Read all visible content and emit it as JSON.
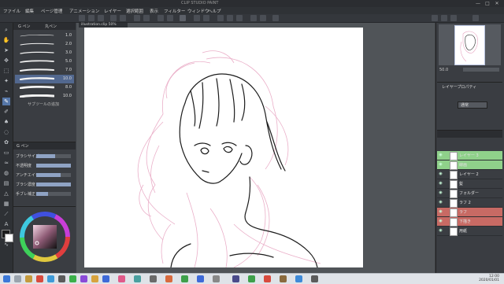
{
  "window": {
    "title": "CLIP STUDIO PAINT",
    "controls": [
      "—",
      "□",
      "✕"
    ]
  },
  "menu": [
    {
      "label": "ファイル"
    },
    {
      "label": "編集"
    },
    {
      "label": "ページ管理"
    },
    {
      "label": "アニメーション"
    },
    {
      "label": "レイヤー"
    },
    {
      "label": "選択範囲"
    },
    {
      "label": "表示"
    },
    {
      "label": "フィルター"
    },
    {
      "label": "ウィンドウ"
    },
    {
      "label": "ヘルプ"
    }
  ],
  "subtool": {
    "tabs": [
      "G ペン",
      "丸ペン"
    ],
    "brushes": [
      {
        "size": "1.0"
      },
      {
        "size": "2.0"
      },
      {
        "size": "3.0"
      },
      {
        "size": "5.0"
      },
      {
        "size": "7.0"
      },
      {
        "size": "10.0"
      },
      {
        "size": "8.0"
      },
      {
        "size": "10.0"
      }
    ],
    "selected_index": 5,
    "footer": "サブツールの追加"
  },
  "tool_property": {
    "title": "G ペン",
    "rows": [
      {
        "label": "ブラシサイズ",
        "fill": 0.55
      },
      {
        "label": "不透明度",
        "fill": 1.0
      },
      {
        "label": "アンチエイリアス",
        "fill": 0.7
      },
      {
        "label": "ブラシ濃度",
        "fill": 1.0
      },
      {
        "label": "手ブレ補正",
        "fill": 0.35
      }
    ]
  },
  "colors": {
    "accent": "#5677a8",
    "layer_highlight": "#8fd18a",
    "layer_red": "#c86a64",
    "sketch": "#e8a7c3",
    "line": "#1c1c1c"
  },
  "canvas": {
    "tab_label": "illustration.clip 50%"
  },
  "navigator": {
    "zoom": "50.0"
  },
  "layer_property": {
    "label": "レイヤープロパティ",
    "blend": "通常"
  },
  "layers": [
    {
      "name": "レイヤー 3",
      "color": "#8fd18a",
      "visible": true
    },
    {
      "name": "線画",
      "color": "#8fd18a",
      "visible": true
    },
    {
      "name": "レイヤー 2",
      "color": "#3a3d42",
      "visible": true
    },
    {
      "name": "髪",
      "color": "#3a3d42",
      "visible": true
    },
    {
      "name": "フォルダー",
      "color": "#3a3d42",
      "visible": true
    },
    {
      "name": "ラフ 2",
      "color": "#3a3d42",
      "visible": true
    },
    {
      "name": "ラフ",
      "color": "#c86a64",
      "visible": true
    },
    {
      "name": "下描き",
      "color": "#c86a64",
      "visible": true
    },
    {
      "name": "用紙",
      "color": "#3a3d42",
      "visible": true
    }
  ],
  "taskbar": {
    "time": "12:00",
    "date": "2020/01/01"
  }
}
